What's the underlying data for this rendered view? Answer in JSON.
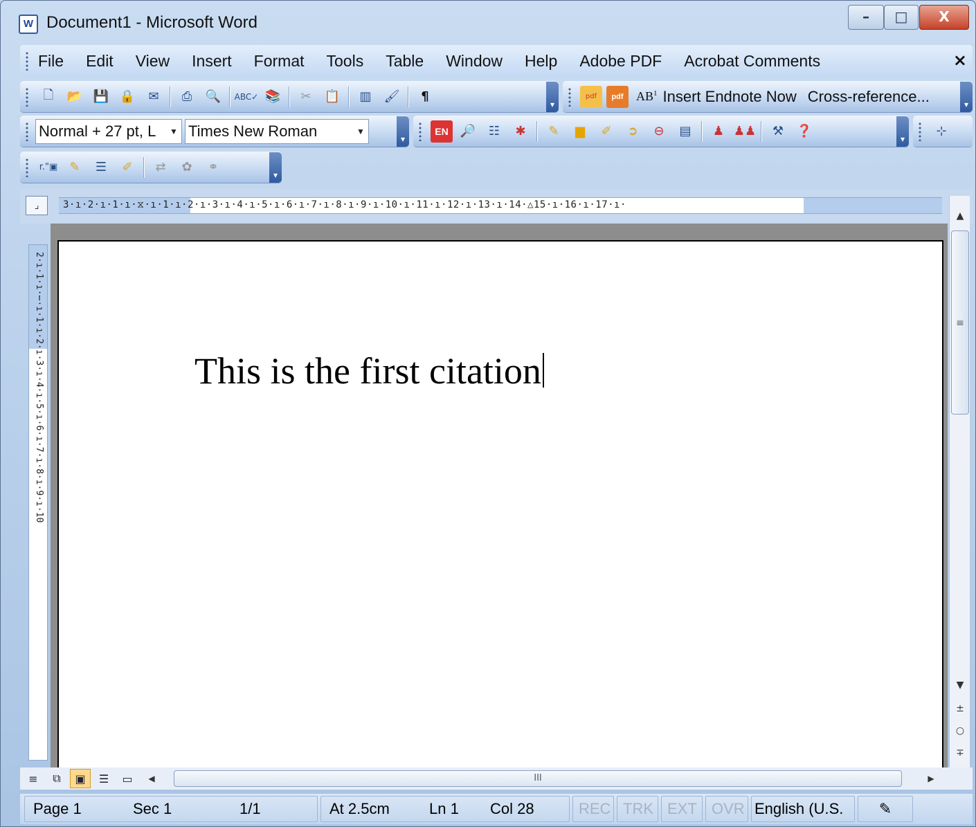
{
  "window": {
    "title": "Document1 - Microsoft Word",
    "app_icon": "word-icon",
    "controls": {
      "minimize": "–",
      "maximize": "□",
      "close": "X"
    }
  },
  "menubar": {
    "items": [
      "File",
      "Edit",
      "View",
      "Insert",
      "Format",
      "Tools",
      "Table",
      "Window",
      "Help",
      "Adobe PDF",
      "Acrobat Comments"
    ],
    "close_glyph": "×"
  },
  "toolbar_standard": {
    "icons": [
      "new-document-icon",
      "open-folder-icon",
      "save-icon",
      "permission-icon",
      "email-icon",
      "print-icon",
      "print-preview-icon",
      "spelling-icon",
      "research-icon",
      "cut-icon",
      "paste-icon",
      "columns-icon",
      "format-painter-icon",
      "paragraph-mark-icon"
    ]
  },
  "toolbar_endnote": {
    "buttons": [
      "Insert Endnote Now",
      "Cross-reference..."
    ],
    "endnote_superscript": "AB",
    "endnote_superscript_mark": "1"
  },
  "toolbar_formatting": {
    "style_value": "Normal + 27 pt, L",
    "font_value": "Times New Roman",
    "endnote_badge": "EN"
  },
  "ruler": {
    "corner_glyph": "⌟",
    "horizontal_ticks": "3·ı·2·ı·1·ı·⧖·ı·1·ı·2·ı·3·ı·4·ı·5·ı·6·ı·7·ı·8·ı·9·ı·10·ı·11·ı·12·ı·13·ı·14·△15·ı·16·ı·17·ı·",
    "vertical_ticks": "2·ı·1·ı·⋯·ı·1·ı·2·ı·3·ı·4·ı·5·ı·6·ı·7·ı·8·ı·9·ı·10"
  },
  "document": {
    "text": "This is the first citation"
  },
  "scrollbar": {
    "up": "▲",
    "down": "▼",
    "prev_page": "±",
    "browse_object": "○",
    "next_page": "∓",
    "left": "◀",
    "right": "▶",
    "thumb_grip": "≡",
    "hthumb_grip": "III"
  },
  "view_buttons": {
    "normal": "≡",
    "web": "⧉",
    "print": "▣",
    "outline": "☰",
    "reading": "▭"
  },
  "statusbar": {
    "page": "Page 1",
    "sec": "Sec 1",
    "pages": "1/1",
    "at": "At 2.5cm",
    "ln": "Ln 1",
    "col": "Col 28",
    "rec": "REC",
    "trk": "TRK",
    "ext": "EXT",
    "ovr": "OVR",
    "language": "English (U.S.",
    "spell_glyph": "✎"
  }
}
